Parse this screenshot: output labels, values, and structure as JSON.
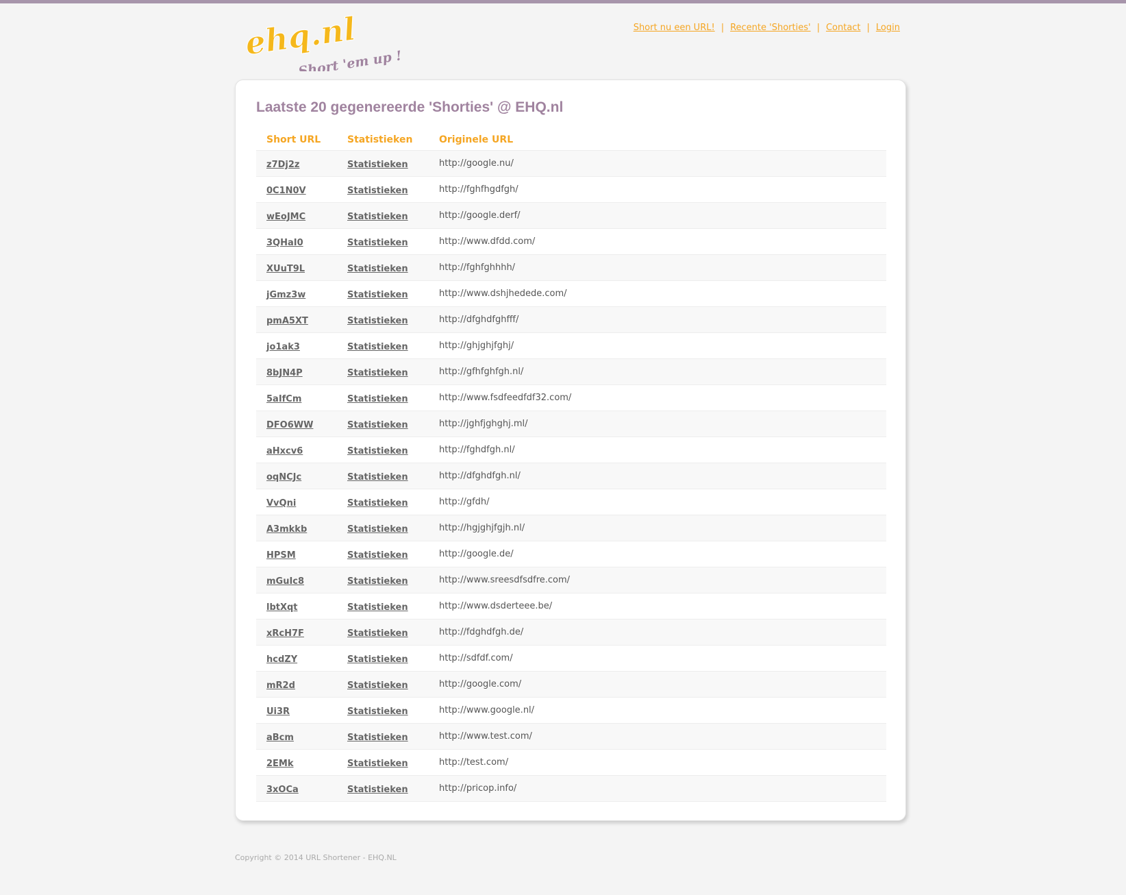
{
  "brand": {
    "logo_text": "ehq.nl",
    "tagline": "Short 'em up !",
    "colors": {
      "logo_orange": "#f5b81c",
      "logo_purple": "#a0839f",
      "accent": "#f5a623",
      "topbar": "#a795ab"
    }
  },
  "nav": {
    "items": [
      {
        "label": "Short nu een URL!"
      },
      {
        "label": "Recente 'Shorties'"
      },
      {
        "label": "Contact"
      },
      {
        "label": "Login"
      }
    ],
    "separator": "|"
  },
  "main": {
    "title": "Laatste 20 gegenereerde 'Shorties' @ EHQ.nl",
    "table": {
      "headers": [
        "Short URL",
        "Statistieken",
        "Originele URL"
      ],
      "rows": [
        {
          "short": "z7Dj2z",
          "stats": "Statistieken",
          "url": "http://google.nu/"
        },
        {
          "short": "0C1N0V",
          "stats": "Statistieken",
          "url": "http://fghfhgdfgh/"
        },
        {
          "short": "wEoJMC",
          "stats": "Statistieken",
          "url": "http://google.derf/"
        },
        {
          "short": "3QHaI0",
          "stats": "Statistieken",
          "url": "http://www.dfdd.com/"
        },
        {
          "short": "XUuT9L",
          "stats": "Statistieken",
          "url": "http://fghfghhhh/"
        },
        {
          "short": "jGmz3w",
          "stats": "Statistieken",
          "url": "http://www.dshjhedede.com/"
        },
        {
          "short": "pmA5XT",
          "stats": "Statistieken",
          "url": "http://dfghdfghfff/"
        },
        {
          "short": "jo1ak3",
          "stats": "Statistieken",
          "url": "http://ghjghjfghj/"
        },
        {
          "short": "8bJN4P",
          "stats": "Statistieken",
          "url": "http://gfhfghfgh.nl/"
        },
        {
          "short": "5aIfCm",
          "stats": "Statistieken",
          "url": "http://www.fsdfeedfdf32.com/"
        },
        {
          "short": "DFO6WW",
          "stats": "Statistieken",
          "url": "http://jghfjghghj.ml/"
        },
        {
          "short": "aHxcv6",
          "stats": "Statistieken",
          "url": "http://fghdfgh.nl/"
        },
        {
          "short": "oqNCJc",
          "stats": "Statistieken",
          "url": "http://dfghdfgh.nl/"
        },
        {
          "short": "VvQni",
          "stats": "Statistieken",
          "url": "http://gfdh/"
        },
        {
          "short": "A3mkkb",
          "stats": "Statistieken",
          "url": "http://hgjghjfgjh.nl/"
        },
        {
          "short": "HPSM",
          "stats": "Statistieken",
          "url": "http://google.de/"
        },
        {
          "short": "mGuIc8",
          "stats": "Statistieken",
          "url": "http://www.sreesdfsdfre.com/"
        },
        {
          "short": "lbtXqt",
          "stats": "Statistieken",
          "url": "http://www.dsderteee.be/"
        },
        {
          "short": "xRcH7F",
          "stats": "Statistieken",
          "url": "http://fdghdfgh.de/"
        },
        {
          "short": "hcdZY",
          "stats": "Statistieken",
          "url": "http://sdfdf.com/"
        },
        {
          "short": "mR2d",
          "stats": "Statistieken",
          "url": "http://google.com/"
        },
        {
          "short": "Ui3R",
          "stats": "Statistieken",
          "url": "http://www.google.nl/"
        },
        {
          "short": "aBcm",
          "stats": "Statistieken",
          "url": "http://www.test.com/"
        },
        {
          "short": "2EMk",
          "stats": "Statistieken",
          "url": "http://test.com/"
        },
        {
          "short": "3xOCa",
          "stats": "Statistieken",
          "url": "http://pricop.info/"
        }
      ]
    }
  },
  "footer": {
    "copyright": "Copyright © 2014 URL Shortener - EHQ.NL"
  }
}
